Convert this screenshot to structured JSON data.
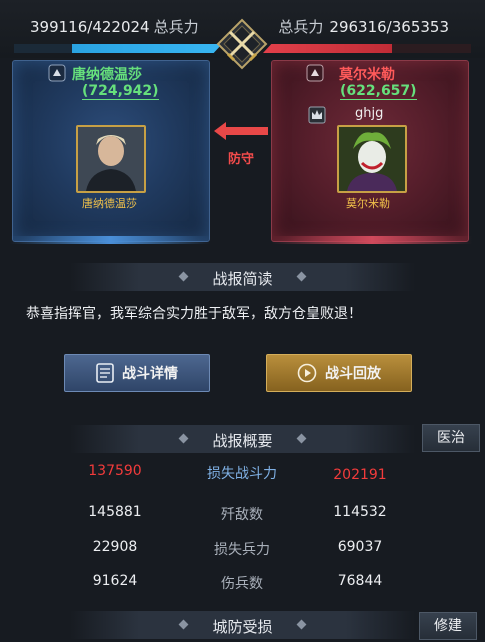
{
  "topbar": {
    "left_troops": "399116/422024",
    "left_label": "总兵力",
    "right_label": "总兵力",
    "right_troops": "296316/365353"
  },
  "player_left": {
    "name": "唐纳德温莎",
    "power": "(724,942)",
    "hero_caption": "唐纳德温莎"
  },
  "player_right": {
    "name": "莫尔米勒",
    "power": "(622,657)",
    "guild": "ghjg",
    "hero_caption": "莫尔米勒"
  },
  "battle": {
    "defend_label": "防守"
  },
  "report_summary": {
    "title": "战报简读",
    "text": "恭喜指挥官，我军综合实力胜于敌军，敌方仓皇败退！",
    "detail_button": "战斗详情",
    "replay_button": "战斗回放"
  },
  "report_overview": {
    "title": "战报概要",
    "heal_button": "医治",
    "rows": [
      {
        "left": "137590",
        "label": "损失战斗力",
        "right": "202191"
      },
      {
        "left": "145881",
        "label": "歼敌数",
        "right": "114532"
      },
      {
        "left": "22908",
        "label": "损失兵力",
        "right": "69037"
      },
      {
        "left": "91624",
        "label": "伤兵数",
        "right": "76844"
      }
    ]
  },
  "city_defense": {
    "title": "城防受损",
    "repair_button": "修建"
  },
  "colors": {
    "friendly": "#38b6f2",
    "enemy": "#e2404a",
    "green_text": "#66e07c",
    "red_value": "#f23b3b"
  }
}
